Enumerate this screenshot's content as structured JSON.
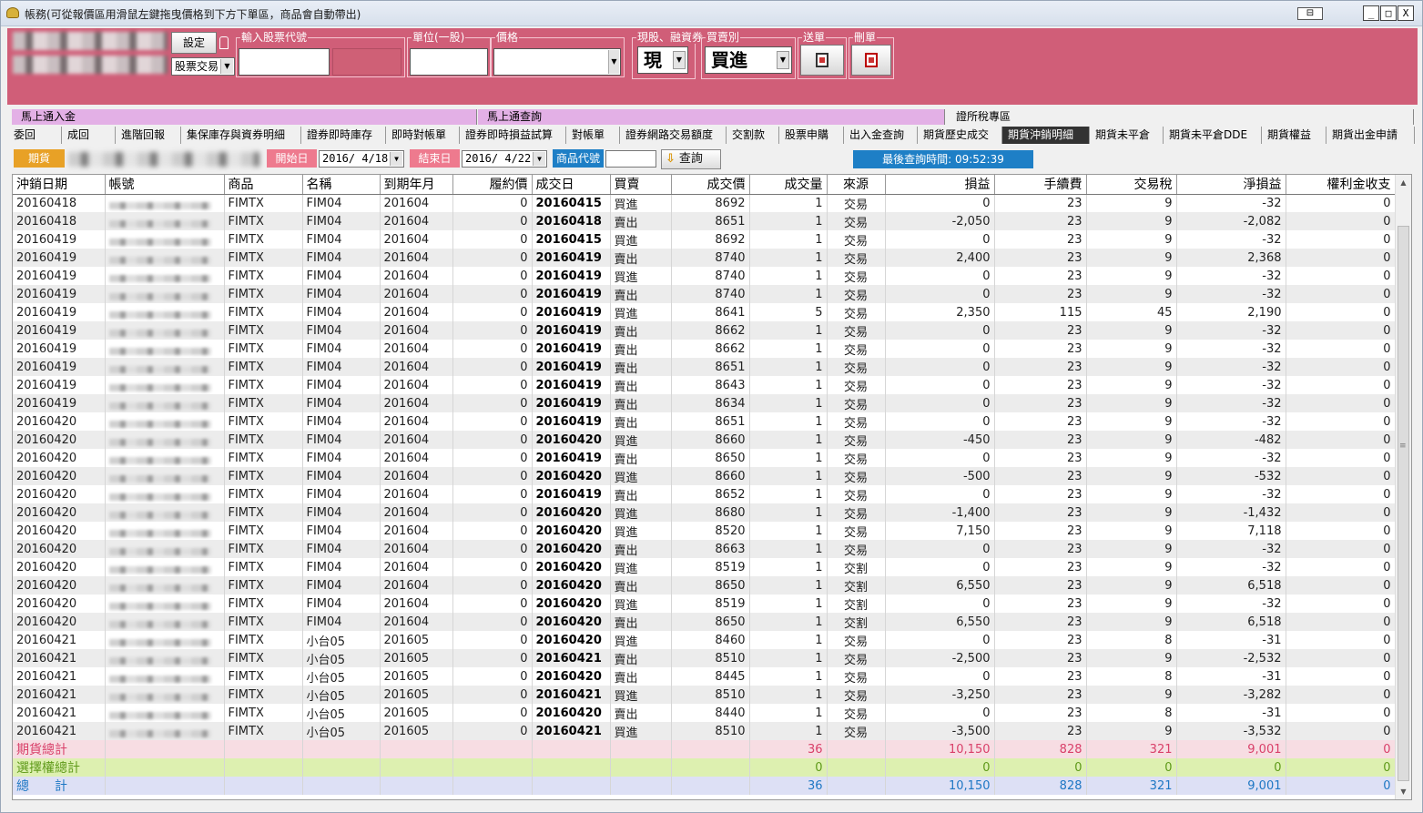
{
  "window": {
    "title": "帳務(可從報價區用滑鼠左鍵拖曳價格到下方下單區，商品會自動帶出)",
    "pin": "⊟",
    "min": "_",
    "max": "□",
    "close": "X"
  },
  "toolbar": {
    "set_label": "設定",
    "trade_type": "股票交易",
    "g_code": "輸入股票代號",
    "g_unit": "單位(一股)",
    "g_price": "價格",
    "g_cash": "現股、融資券",
    "g_side": "買賣別",
    "g_send": "送單",
    "g_del": "刪單",
    "cash_value": "現",
    "side_value": "買進"
  },
  "links": [
    "馬上通入金",
    "馬上通查詢",
    "證所稅專區"
  ],
  "tabs": [
    "委回",
    "成回",
    "進階回報",
    "集保庫存與資券明細",
    "證券即時庫存",
    "即時對帳單",
    "證券即時損益試算",
    "對帳單",
    "證券網路交易額度",
    "交割款",
    "股票申購",
    "出入金查詢",
    "期貨歷史成交",
    "期貨沖銷明細",
    "期貨未平倉",
    "期貨未平倉DDE",
    "期貨權益",
    "期貨出金申請"
  ],
  "active_tab": "期貨沖銷明細",
  "query": {
    "market_label": "期貨",
    "start_label": "開始日",
    "start_value": "2016/ 4/18",
    "end_label": "結束日",
    "end_value": "2016/ 4/22",
    "code_label": "商品代號",
    "code_value": "",
    "search_label": "查詢",
    "last_query": "最後查詢時間: 09:52:39"
  },
  "colors": {
    "toolbar": "#d05e78",
    "sum_futures": "#d9406a",
    "sum_options": "#5f9a1a",
    "sum_total": "#1e77c4",
    "last_query_bg": "#1e7fc6"
  },
  "table": {
    "headers": [
      "沖銷日期",
      "帳號",
      "商品",
      "名稱",
      "到期年月",
      "履約價",
      "成交日",
      "買賣",
      "成交價",
      "成交量",
      "來源",
      "損益",
      "手續費",
      "交易稅",
      "淨損益",
      "權利金收支"
    ],
    "rows": [
      [
        "20160418",
        "FIMTX",
        "FIM04",
        "201604",
        "0",
        "20160415",
        "買進",
        "8692",
        "1",
        "交易",
        "0",
        "23",
        "9",
        "-32",
        "0"
      ],
      [
        "20160418",
        "FIMTX",
        "FIM04",
        "201604",
        "0",
        "20160418",
        "賣出",
        "8651",
        "1",
        "交易",
        "-2,050",
        "23",
        "9",
        "-2,082",
        "0"
      ],
      [
        "20160419",
        "FIMTX",
        "FIM04",
        "201604",
        "0",
        "20160415",
        "買進",
        "8692",
        "1",
        "交易",
        "0",
        "23",
        "9",
        "-32",
        "0"
      ],
      [
        "20160419",
        "FIMTX",
        "FIM04",
        "201604",
        "0",
        "20160419",
        "賣出",
        "8740",
        "1",
        "交易",
        "2,400",
        "23",
        "9",
        "2,368",
        "0"
      ],
      [
        "20160419",
        "FIMTX",
        "FIM04",
        "201604",
        "0",
        "20160419",
        "買進",
        "8740",
        "1",
        "交易",
        "0",
        "23",
        "9",
        "-32",
        "0"
      ],
      [
        "20160419",
        "FIMTX",
        "FIM04",
        "201604",
        "0",
        "20160419",
        "賣出",
        "8740",
        "1",
        "交易",
        "0",
        "23",
        "9",
        "-32",
        "0"
      ],
      [
        "20160419",
        "FIMTX",
        "FIM04",
        "201604",
        "0",
        "20160419",
        "買進",
        "8641",
        "5",
        "交易",
        "2,350",
        "115",
        "45",
        "2,190",
        "0"
      ],
      [
        "20160419",
        "FIMTX",
        "FIM04",
        "201604",
        "0",
        "20160419",
        "賣出",
        "8662",
        "1",
        "交易",
        "0",
        "23",
        "9",
        "-32",
        "0"
      ],
      [
        "20160419",
        "FIMTX",
        "FIM04",
        "201604",
        "0",
        "20160419",
        "賣出",
        "8662",
        "1",
        "交易",
        "0",
        "23",
        "9",
        "-32",
        "0"
      ],
      [
        "20160419",
        "FIMTX",
        "FIM04",
        "201604",
        "0",
        "20160419",
        "賣出",
        "8651",
        "1",
        "交易",
        "0",
        "23",
        "9",
        "-32",
        "0"
      ],
      [
        "20160419",
        "FIMTX",
        "FIM04",
        "201604",
        "0",
        "20160419",
        "賣出",
        "8643",
        "1",
        "交易",
        "0",
        "23",
        "9",
        "-32",
        "0"
      ],
      [
        "20160419",
        "FIMTX",
        "FIM04",
        "201604",
        "0",
        "20160419",
        "賣出",
        "8634",
        "1",
        "交易",
        "0",
        "23",
        "9",
        "-32",
        "0"
      ],
      [
        "20160420",
        "FIMTX",
        "FIM04",
        "201604",
        "0",
        "20160419",
        "賣出",
        "8651",
        "1",
        "交易",
        "0",
        "23",
        "9",
        "-32",
        "0"
      ],
      [
        "20160420",
        "FIMTX",
        "FIM04",
        "201604",
        "0",
        "20160420",
        "買進",
        "8660",
        "1",
        "交易",
        "-450",
        "23",
        "9",
        "-482",
        "0"
      ],
      [
        "20160420",
        "FIMTX",
        "FIM04",
        "201604",
        "0",
        "20160419",
        "賣出",
        "8650",
        "1",
        "交易",
        "0",
        "23",
        "9",
        "-32",
        "0"
      ],
      [
        "20160420",
        "FIMTX",
        "FIM04",
        "201604",
        "0",
        "20160420",
        "買進",
        "8660",
        "1",
        "交易",
        "-500",
        "23",
        "9",
        "-532",
        "0"
      ],
      [
        "20160420",
        "FIMTX",
        "FIM04",
        "201604",
        "0",
        "20160419",
        "賣出",
        "8652",
        "1",
        "交易",
        "0",
        "23",
        "9",
        "-32",
        "0"
      ],
      [
        "20160420",
        "FIMTX",
        "FIM04",
        "201604",
        "0",
        "20160420",
        "買進",
        "8680",
        "1",
        "交易",
        "-1,400",
        "23",
        "9",
        "-1,432",
        "0"
      ],
      [
        "20160420",
        "FIMTX",
        "FIM04",
        "201604",
        "0",
        "20160420",
        "買進",
        "8520",
        "1",
        "交易",
        "7,150",
        "23",
        "9",
        "7,118",
        "0"
      ],
      [
        "20160420",
        "FIMTX",
        "FIM04",
        "201604",
        "0",
        "20160420",
        "賣出",
        "8663",
        "1",
        "交易",
        "0",
        "23",
        "9",
        "-32",
        "0"
      ],
      [
        "20160420",
        "FIMTX",
        "FIM04",
        "201604",
        "0",
        "20160420",
        "買進",
        "8519",
        "1",
        "交割",
        "0",
        "23",
        "9",
        "-32",
        "0"
      ],
      [
        "20160420",
        "FIMTX",
        "FIM04",
        "201604",
        "0",
        "20160420",
        "賣出",
        "8650",
        "1",
        "交割",
        "6,550",
        "23",
        "9",
        "6,518",
        "0"
      ],
      [
        "20160420",
        "FIMTX",
        "FIM04",
        "201604",
        "0",
        "20160420",
        "買進",
        "8519",
        "1",
        "交割",
        "0",
        "23",
        "9",
        "-32",
        "0"
      ],
      [
        "20160420",
        "FIMTX",
        "FIM04",
        "201604",
        "0",
        "20160420",
        "賣出",
        "8650",
        "1",
        "交割",
        "6,550",
        "23",
        "9",
        "6,518",
        "0"
      ],
      [
        "20160421",
        "FIMTX",
        "小台05",
        "201605",
        "0",
        "20160420",
        "買進",
        "8460",
        "1",
        "交易",
        "0",
        "23",
        "8",
        "-31",
        "0"
      ],
      [
        "20160421",
        "FIMTX",
        "小台05",
        "201605",
        "0",
        "20160421",
        "賣出",
        "8510",
        "1",
        "交易",
        "-2,500",
        "23",
        "9",
        "-2,532",
        "0"
      ],
      [
        "20160421",
        "FIMTX",
        "小台05",
        "201605",
        "0",
        "20160420",
        "賣出",
        "8445",
        "1",
        "交易",
        "0",
        "23",
        "8",
        "-31",
        "0"
      ],
      [
        "20160421",
        "FIMTX",
        "小台05",
        "201605",
        "0",
        "20160421",
        "買進",
        "8510",
        "1",
        "交易",
        "-3,250",
        "23",
        "9",
        "-3,282",
        "0"
      ],
      [
        "20160421",
        "FIMTX",
        "小台05",
        "201605",
        "0",
        "20160420",
        "賣出",
        "8440",
        "1",
        "交易",
        "0",
        "23",
        "8",
        "-31",
        "0"
      ],
      [
        "20160421",
        "FIMTX",
        "小台05",
        "201605",
        "0",
        "20160421",
        "買進",
        "8510",
        "1",
        "交易",
        "-3,500",
        "23",
        "9",
        "-3,532",
        "0"
      ]
    ],
    "summary": [
      {
        "label": "期貨總計",
        "qty": "36",
        "pl": "10,150",
        "fee": "828",
        "tax": "321",
        "net": "9,001",
        "prem": "0"
      },
      {
        "label": "選擇權總計",
        "qty": "0",
        "pl": "0",
        "fee": "0",
        "tax": "0",
        "net": "0",
        "prem": "0"
      },
      {
        "label": "總　　計",
        "qty": "36",
        "pl": "10,150",
        "fee": "828",
        "tax": "321",
        "net": "9,001",
        "prem": "0"
      }
    ]
  }
}
